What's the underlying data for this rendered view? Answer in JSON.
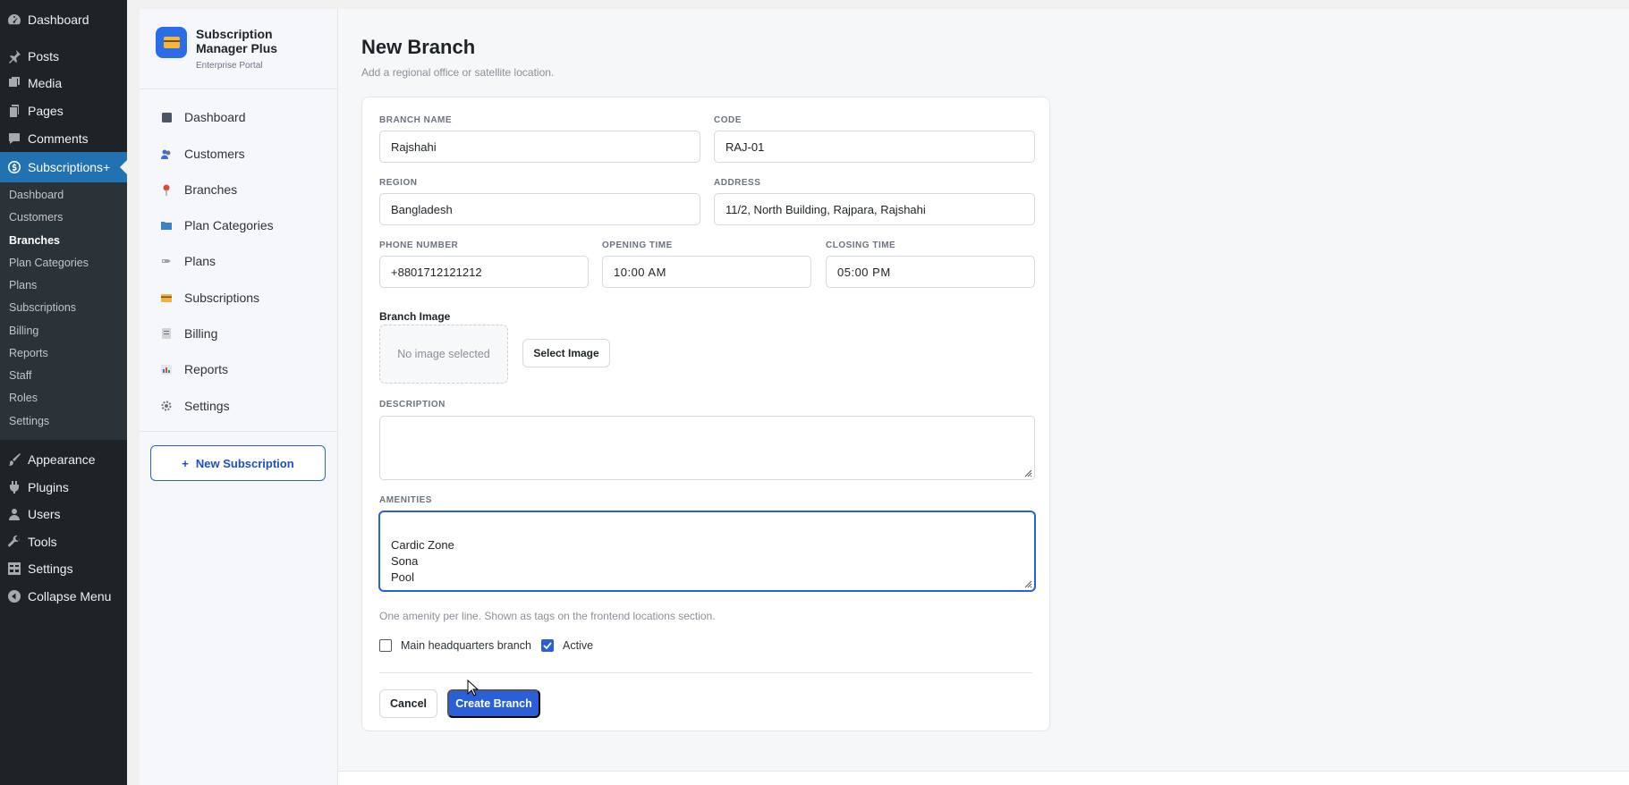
{
  "wp_menu": {
    "items": [
      {
        "label": "Dashboard",
        "icon": "dashboard-icon"
      },
      {
        "label": "Posts",
        "icon": "pin-icon"
      },
      {
        "label": "Media",
        "icon": "media-icon"
      },
      {
        "label": "Pages",
        "icon": "pages-icon"
      },
      {
        "label": "Comments",
        "icon": "comments-icon"
      },
      {
        "label": "Subscriptions+",
        "icon": "dollar-icon"
      },
      {
        "label": "Appearance",
        "icon": "brush-icon"
      },
      {
        "label": "Plugins",
        "icon": "plugin-icon"
      },
      {
        "label": "Users",
        "icon": "users-icon"
      },
      {
        "label": "Tools",
        "icon": "wrench-icon"
      },
      {
        "label": "Settings",
        "icon": "settings-icon"
      },
      {
        "label": "Collapse Menu",
        "icon": "collapse-icon"
      }
    ],
    "submenu": [
      "Dashboard",
      "Customers",
      "Branches",
      "Plan Categories",
      "Plans",
      "Subscriptions",
      "Billing",
      "Reports",
      "Staff",
      "Roles",
      "Settings"
    ],
    "active_submenu": "Branches"
  },
  "plugin": {
    "name": "Subscription Manager Plus",
    "subtitle": "Enterprise Portal",
    "nav": [
      {
        "label": "Dashboard",
        "icon": "dashboard-icon"
      },
      {
        "label": "Customers",
        "icon": "customers-icon"
      },
      {
        "label": "Branches",
        "icon": "location-pin-icon"
      },
      {
        "label": "Plan Categories",
        "icon": "folder-icon"
      },
      {
        "label": "Plans",
        "icon": "tag-icon"
      },
      {
        "label": "Subscriptions",
        "icon": "credit-card-icon"
      },
      {
        "label": "Billing",
        "icon": "receipt-icon"
      },
      {
        "label": "Reports",
        "icon": "bar-chart-icon"
      },
      {
        "label": "Settings",
        "icon": "gear-icon"
      }
    ],
    "new_subscription": {
      "plus": "+",
      "label": "New Subscription"
    }
  },
  "page": {
    "title": "New Branch",
    "subtitle": "Add a regional office or satellite location."
  },
  "form": {
    "branch_name": {
      "label": "BRANCH NAME",
      "value": "Rajshahi"
    },
    "code": {
      "label": "CODE",
      "value": "RAJ-01"
    },
    "region": {
      "label": "REGION",
      "value": "Bangladesh"
    },
    "address": {
      "label": "ADDRESS",
      "value": "11/2, North Building, Rajpara, Rajshahi"
    },
    "phone": {
      "label": "PHONE NUMBER",
      "value": "+8801712121212"
    },
    "opening_time": {
      "label": "OPENING TIME",
      "value": "10:00 AM"
    },
    "closing_time": {
      "label": "CLOSING TIME",
      "value": "05:00 PM"
    },
    "branch_image": {
      "label": "Branch Image",
      "placeholder": "No image selected",
      "button": "Select Image"
    },
    "description": {
      "label": "DESCRIPTION",
      "value": ""
    },
    "amenities": {
      "label": "AMENITIES",
      "value": "Cardic Zone\nSona\nPool",
      "hint": "One amenity per line. Shown as tags on the frontend locations section."
    },
    "main_hq": {
      "label": "Main headquarters branch",
      "checked": false
    },
    "active": {
      "label": "Active",
      "checked": true
    },
    "cancel": "Cancel",
    "submit": "Create Branch"
  },
  "colors": {
    "accent": "#2b5fd9",
    "wp_menu_bg": "#1d2327",
    "wp_current": "#2271b1"
  }
}
